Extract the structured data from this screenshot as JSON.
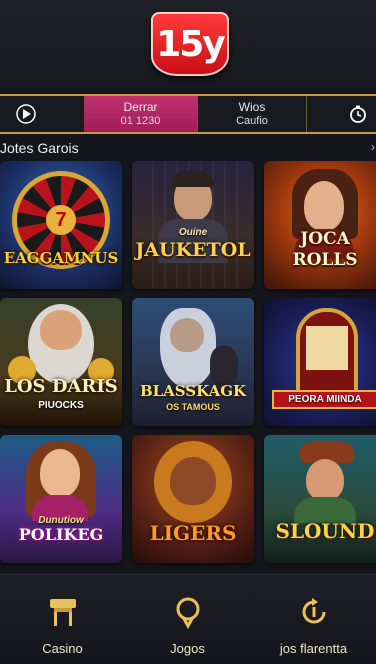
{
  "header": {
    "logo_text": "15y"
  },
  "tabs": [
    {
      "label": "Derrar",
      "sub": "01 1230"
    },
    {
      "label": "Wios",
      "sub": "Caufio"
    }
  ],
  "section": {
    "title": "Jotes Garois",
    "more": "›"
  },
  "games": [
    {
      "title": "EAGGAMNUS",
      "subtitle": ""
    },
    {
      "title": "JAUKETOL",
      "subtitle": "Ouine"
    },
    {
      "title": "JOCA ROLLS",
      "subtitle": ""
    },
    {
      "title": "LOS DARIS",
      "subtitle": "PIUOCKS"
    },
    {
      "title": "BLASSKAGK",
      "subtitle": "OS TAMOUS"
    },
    {
      "title": "",
      "subtitle": "PEORA MIINDA"
    },
    {
      "title": "POLIKEG",
      "subtitle": "Dunutiow"
    },
    {
      "title": "LIGERS",
      "subtitle": ""
    },
    {
      "title": "SLOUND",
      "subtitle": ""
    }
  ],
  "bottom_nav": [
    {
      "label": "Casino",
      "icon": "casino-icon"
    },
    {
      "label": "Jogos",
      "icon": "pin-icon"
    },
    {
      "label": "jos flarentta",
      "icon": "refresh-icon"
    }
  ],
  "colors": {
    "accent": "#b52463",
    "gold": "#c99a3b",
    "brand_red": "#e21b23"
  }
}
